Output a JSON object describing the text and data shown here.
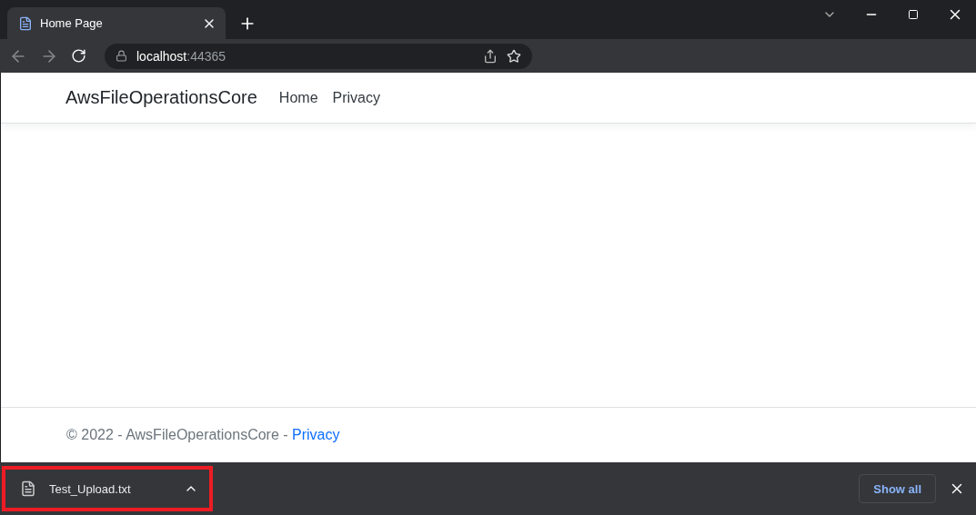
{
  "tabs": [
    {
      "title": "Home Page",
      "selected": true
    }
  ],
  "address_bar": {
    "host": "localhost",
    "port": ":44365"
  },
  "navbar": {
    "brand": "AwsFileOperationsCore",
    "links": [
      "Home",
      "Privacy"
    ]
  },
  "footer": {
    "text": "© 2022 - AwsFileOperationsCore - ",
    "link": "Privacy"
  },
  "download_bar": {
    "items": [
      {
        "file_name": "Test_Upload.txt",
        "highlighted": true
      }
    ],
    "show_all": "Show all"
  }
}
